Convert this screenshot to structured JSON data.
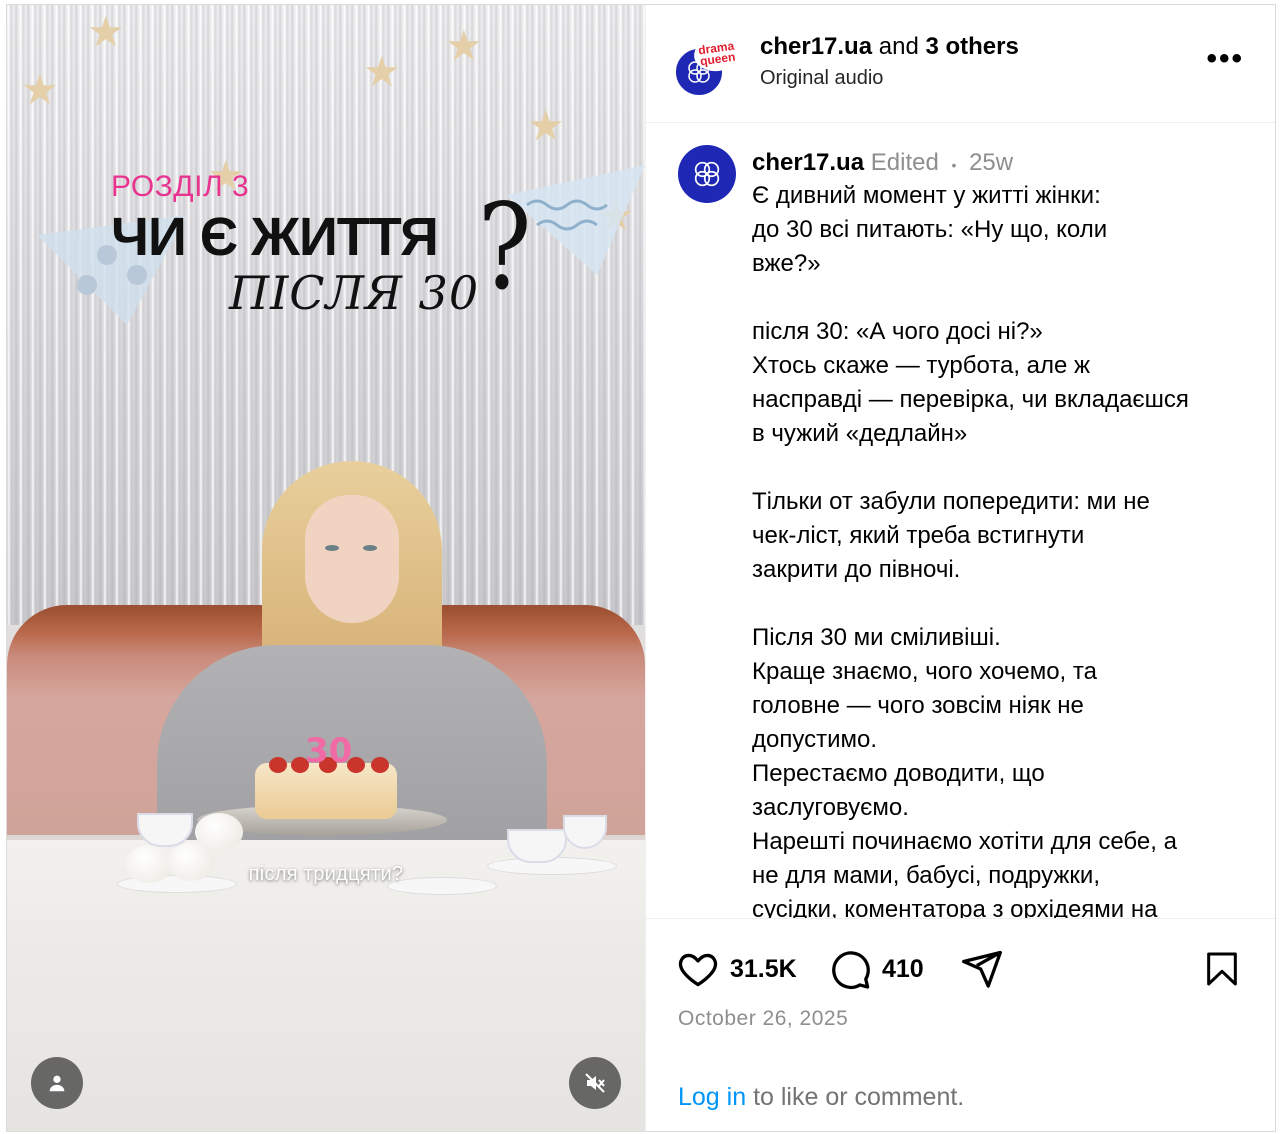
{
  "video": {
    "chapter": "РОЗДІЛ 3",
    "headline_line1": "ЧИ Є ЖИТТЯ",
    "headline_line2": "ПІСЛЯ 30",
    "question_mark": "?",
    "subtitle": "після тридцяти?",
    "candle_text": "30",
    "profile_button_icon": "user-icon",
    "mute_button_icon": "muted-speaker-icon",
    "accent_color": "#e8348f"
  },
  "header": {
    "username": "cher17.ua",
    "and_text": "and",
    "others": "3 others",
    "audio": "Original audio",
    "badge_text": "drama queen",
    "more_icon": "more-horizontal-icon",
    "more_label": "•••"
  },
  "caption": {
    "username": "cher17.ua",
    "edited": "Edited",
    "separator": "•",
    "age": "25w",
    "text": "Є дивний момент у житті жінки:\nдо 30 всі питають: «Ну що, коли\nвже?»\n\nпісля 30: «А чого досі ні?»\nХтось скаже — турбота, але ж\nнасправді — перевірка, чи вкладаєшся\nв чужий «дедлайн»\n\nТільки от забули попередити: ми не\nчек-ліст, який треба встигнути\nзакрити до півночі.\n\nПісля 30 ми сміливіші.\nКраще знаємо, чого хочемо, та\nголовне — чого зовсім ніяк не\nдопустимо.\nПерестаємо доводити, що\nзаслуговуємо.\nНарешті починаємо хотіти для себе, а\nне для мами, бабусі, подружки,\nсусідки, коментатора з орхідеями на"
  },
  "actions": {
    "likes": "31.5K",
    "comments": "410",
    "like_icon": "heart-icon",
    "comment_icon": "comment-icon",
    "share_icon": "send-icon",
    "save_icon": "bookmark-icon"
  },
  "date": "October 26, 2025",
  "login_prompt": {
    "link": "Log in",
    "rest": " to like or comment."
  },
  "colors": {
    "brand_blue": "#1e28b4",
    "link_blue": "#0095f6",
    "muted_gray": "#8e8e8e"
  }
}
